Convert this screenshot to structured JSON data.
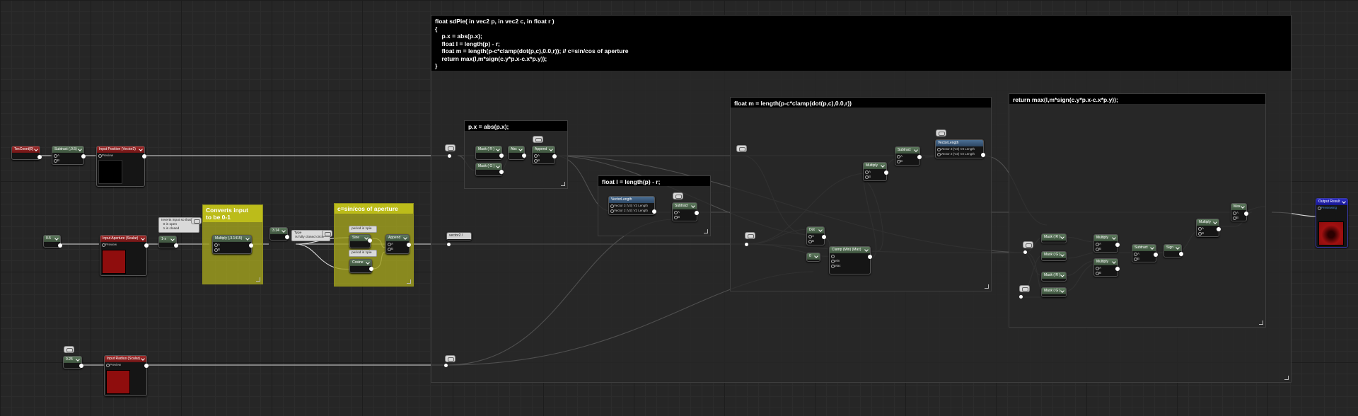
{
  "code_comment": {
    "lines": [
      "float sdPie( in vec2 p, in vec2 c, in float r )",
      "{",
      "    p.x = abs(p.x);",
      "    float l = length(p) - r;",
      "    float m = length(p-c*clamp(dot(p,c),0.0,r)); // c=sin/cos of aperture",
      "    return max(l,m*sign(c.y*p.x-c.x*p.y));",
      "}"
    ]
  },
  "comments": {
    "px_abs": "p.x = abs(p.x);",
    "length_r": "float l = length(p) - r;",
    "float_m": "float m = length(p-c*clamp(dot(p,c),0.0,r))",
    "return_max": "return max(l,m*sign(c.y*p.x-c.x*p.y));",
    "converts": "Converts input\nto be 0-1",
    "sincos": "c=sin/cos of aperture"
  },
  "notes": {
    "inverts": "Inverts input so that\n  0 is open\n  1 is closed",
    "type": "Type\n is fully closed circle",
    "period1": "period is 1pie",
    "period2": "period is 1pie"
  },
  "nodes": {
    "texcoord": "TexCoord[0]",
    "subtract_05": "Subtract (,0.5)",
    "input_position": "Input Position (Vector2)",
    "preview": "Preview",
    "const_a": "0.5",
    "input_aperture": "Input Aperture (Scalar)",
    "one_minus": "1-x",
    "multiply_pi": "Multiply (,3.1415)",
    "const_b": "3.14",
    "sine": "Sine",
    "cosine": "Cosine",
    "append1": "Append",
    "vector2": "vector2 /",
    "const_c": "0.25",
    "input_radius": "Input Radius (Scalar)",
    "mask_r": "Mask ( R )",
    "mask_g": "Mask ( G )",
    "abs": "Abs",
    "append2": "Append",
    "vector_length": "VectorLength",
    "vl_in1": "Vector 3 (V3) V3 Length",
    "vl_in2": "Vector 2 (V2) V2 Length",
    "subtract1": "Subtract",
    "dot": "Dot",
    "clamp": "Clamp (Min) (Max)",
    "const_d": "0",
    "multiply1": "Multiply",
    "subtract2": "Subtract",
    "vector_length2": "VectorLength",
    "mask_r2": "Mask ( R )",
    "mask_g2": "Mask ( G )",
    "mask_r3": "Mask ( R )",
    "mask_g3": "Mask ( G )",
    "multiply2": "Multiply",
    "multiply3": "Multiply",
    "subtract3": "Subtract",
    "sign": "Sign",
    "multiply4": "Multiply",
    "max": "Max",
    "output_result": "Output Result",
    "previewing": "Previewing"
  },
  "pins": {
    "a": "A",
    "b": "B",
    "min": "Min",
    "max": "Max"
  },
  "colors": {
    "wire": "#d9d9d9",
    "comment_header": "#000000",
    "yellow_comment": "#bcbc1a",
    "input_red": "#a32b2b",
    "output_blue": "#2d2dc4"
  }
}
